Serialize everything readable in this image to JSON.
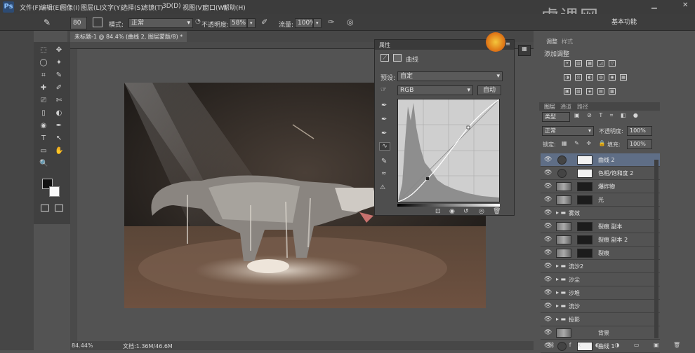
{
  "app": {
    "logo": "Ps"
  },
  "menu": [
    "文件(F)",
    "编辑(E)",
    "图像(I)",
    "图层(L)",
    "文字(Y)",
    "选择(S)",
    "滤镜(T)",
    "3D(D)",
    "视图(V)",
    "窗口(W)",
    "帮助(H)"
  ],
  "options": {
    "brush_size": "80",
    "mode_label": "模式:",
    "mode_value": "正常",
    "opacity_label": "不透明度:",
    "opacity_value": "58%",
    "flow_label": "流量:",
    "flow_value": "100%",
    "workspace": "基本功能"
  },
  "document": {
    "tab_title": "未标题-1 @ 84.4% (曲线 2, 图层蒙版/8) *"
  },
  "status": {
    "zoom": "84.44%",
    "doc_info": "文档:1.36M/46.6M"
  },
  "properties": {
    "panel_title": "属性",
    "type_label": "曲线",
    "preset_label": "预设:",
    "preset_value": "自定",
    "channel_value": "RGB",
    "auto_button": "自动"
  },
  "adjustments": {
    "tab_label": "调整",
    "tab2_label": "样式",
    "subtitle": "添加调整"
  },
  "layers": {
    "tabs": [
      "图层",
      "通道",
      "路径"
    ],
    "filter_value": "类型",
    "blend_mode": "正常",
    "opacity_label": "不透明度:",
    "opacity_value": "100%",
    "lock_label": "锁定:",
    "fill_label": "填充:",
    "fill_value": "100%",
    "items": [
      {
        "name": "曲线 2",
        "kind": "adjust",
        "selected": true
      },
      {
        "name": "色相/饱和度 2",
        "kind": "adjust",
        "selected": false
      },
      {
        "name": "爆炸物",
        "kind": "image",
        "selected": false
      },
      {
        "name": "光",
        "kind": "image",
        "selected": false
      },
      {
        "name": "雾效",
        "kind": "folder",
        "selected": false
      },
      {
        "name": "裂痕 副本",
        "kind": "image",
        "selected": false
      },
      {
        "name": "裂痕 副本 2",
        "kind": "image",
        "selected": false
      },
      {
        "name": "裂痕",
        "kind": "image",
        "selected": false
      },
      {
        "name": "流沙2",
        "kind": "folder",
        "selected": false
      },
      {
        "name": "沙尘",
        "kind": "folder",
        "selected": false
      },
      {
        "name": "沙堆",
        "kind": "folder",
        "selected": false
      },
      {
        "name": "流沙",
        "kind": "folder",
        "selected": false
      },
      {
        "name": "投影",
        "kind": "folder",
        "selected": false
      },
      {
        "name": "背景",
        "kind": "image",
        "selected": false
      },
      {
        "name": "曲线 1",
        "kind": "adjust",
        "selected": false
      }
    ]
  },
  "watermark": "虎课网"
}
